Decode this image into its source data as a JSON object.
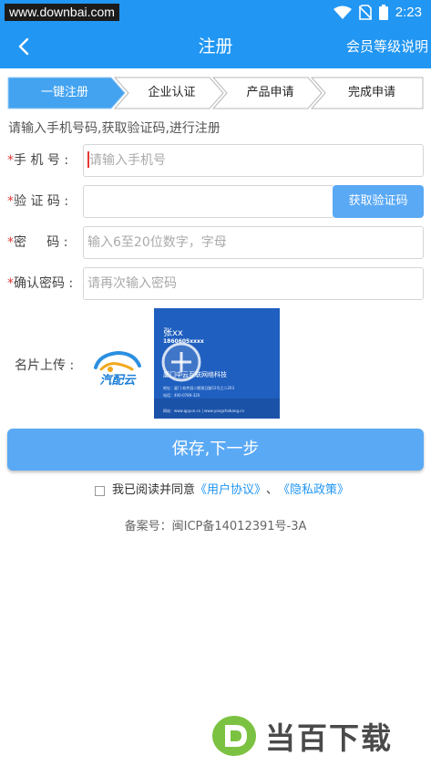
{
  "status_bar": {
    "watermark": "www.downbai.com",
    "time": "2:23"
  },
  "app_bar": {
    "title": "注册",
    "right_link": "会员等级说明"
  },
  "steps": [
    {
      "label": "一键注册",
      "active": true
    },
    {
      "label": "企业认证",
      "active": false
    },
    {
      "label": "产品申请",
      "active": false
    },
    {
      "label": "完成申请",
      "active": false
    }
  ],
  "hint": "请输入手机号码,获取验证码,进行注册",
  "form": {
    "required_mark": "*",
    "phone": {
      "label": "手 机 号 :",
      "placeholder": "请输入手机号"
    },
    "code": {
      "label": "验 证 码 :",
      "button": "获取验证码"
    },
    "password": {
      "label": "密     码 :",
      "placeholder": "输入6至20位数字，字母"
    },
    "confirm": {
      "label": "确认密码 :",
      "placeholder": "请再次输入密码"
    }
  },
  "card_upload": {
    "label": "名片上传 :",
    "logo_text": "汽配云",
    "card_name": "张xx",
    "card_phone": "1860605xxxx",
    "card_company": "厦门中云互联网络科技",
    "card_lines": [
      "地址：厦门·软件园二期观日路52号之二203",
      "电话：400-0789-320",
      "邮箱：zhxl@qpyun.cn",
      "网站：www.qpyun.cn  |  www.yangchebang.cn"
    ]
  },
  "save_button": "保存,下一步",
  "agreement": {
    "prefix": "我已阅读并同意",
    "user_agreement": "《用户协议》",
    "separator": "、",
    "privacy": "《隐私政策》"
  },
  "icp": "备案号：闽ICP备14012391号-3A",
  "footer_watermark": "当百下载",
  "colors": {
    "primary": "#2196f3",
    "button": "#5aa9f5",
    "required": "#e53935"
  }
}
